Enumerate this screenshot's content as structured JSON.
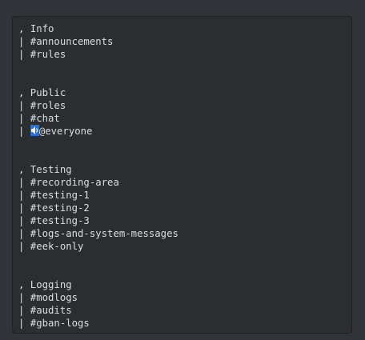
{
  "code_block": {
    "sections": [
      {
        "header": ", Info",
        "channels": [
          "| #announcements",
          "| #rules"
        ]
      },
      {
        "header": ", Public",
        "channels": [
          "| #roles",
          "| #chat"
        ],
        "voice_line": {
          "prefix": "| ",
          "icon": "speaker-icon",
          "text": "@everyone"
        }
      },
      {
        "header": ", Testing",
        "channels": [
          "| #recording-area",
          "| #testing-1",
          "| #testing-2",
          "| #testing-3",
          "| #logs-and-system-messages",
          "| #eek-only"
        ]
      },
      {
        "header": ", Logging",
        "channels": [
          "| #modlogs",
          "| #audits",
          "| #gban-logs"
        ]
      }
    ]
  },
  "colors": {
    "background": "#313338",
    "code_block_background": "#2b2d31",
    "text": "#dbdee1",
    "selection": "#2b6fd6"
  }
}
